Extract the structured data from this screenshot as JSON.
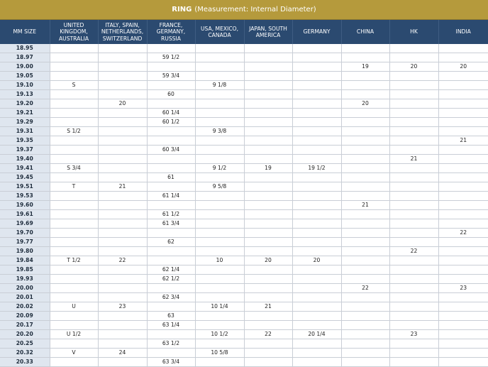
{
  "title": {
    "strong": "RING",
    "rest": "(Measurement: Internal Diameter)"
  },
  "headers": [
    "MM SIZE",
    "UNITED KINGDOM, AUSTRALIA",
    "ITALY, SPAIN, NETHERLANDS, SWITZERLAND",
    "FRANCE, GERMANY, RUSSIA",
    "USA, MEXICO, CANADA",
    "JAPAN, SOUTH AMERICA",
    "GERMANY",
    "CHINA",
    "HK",
    "INDIA"
  ],
  "rows": [
    [
      "18.95",
      "",
      "",
      "",
      "",
      "",
      "",
      "",
      "",
      ""
    ],
    [
      "18.97",
      "",
      "",
      "59 1/2",
      "",
      "",
      "",
      "",
      "",
      ""
    ],
    [
      "19.00",
      "",
      "",
      "",
      "",
      "",
      "",
      "19",
      "20",
      "20"
    ],
    [
      "19.05",
      "",
      "",
      "59 3/4",
      "",
      "",
      "",
      "",
      "",
      ""
    ],
    [
      "19.10",
      "S",
      "",
      "",
      "9 1/8",
      "",
      "",
      "",
      "",
      ""
    ],
    [
      "19.13",
      "",
      "",
      "60",
      "",
      "",
      "",
      "",
      "",
      ""
    ],
    [
      "19.20",
      "",
      "20",
      "",
      "",
      "",
      "",
      "20",
      "",
      ""
    ],
    [
      "19.21",
      "",
      "",
      "60 1/4",
      "",
      "",
      "",
      "",
      "",
      ""
    ],
    [
      "19.29",
      "",
      "",
      "60 1/2",
      "",
      "",
      "",
      "",
      "",
      ""
    ],
    [
      "19.31",
      "S 1/2",
      "",
      "",
      "9 3/8",
      "",
      "",
      "",
      "",
      ""
    ],
    [
      "19.35",
      "",
      "",
      "",
      "",
      "",
      "",
      "",
      "",
      "21"
    ],
    [
      "19.37",
      "",
      "",
      "60 3/4",
      "",
      "",
      "",
      "",
      "",
      ""
    ],
    [
      "19.40",
      "",
      "",
      "",
      "",
      "",
      "",
      "",
      "21",
      ""
    ],
    [
      "19.41",
      "S 3/4",
      "",
      "",
      "9 1/2",
      "19",
      "19 1/2",
      "",
      "",
      ""
    ],
    [
      "19.45",
      "",
      "",
      "61",
      "",
      "",
      "",
      "",
      "",
      ""
    ],
    [
      "19.51",
      "T",
      "21",
      "",
      "9 5/8",
      "",
      "",
      "",
      "",
      ""
    ],
    [
      "19.53",
      "",
      "",
      "61 1/4",
      "",
      "",
      "",
      "",
      "",
      ""
    ],
    [
      "19.60",
      "",
      "",
      "",
      "",
      "",
      "",
      "21",
      "",
      ""
    ],
    [
      "19.61",
      "",
      "",
      "61 1/2",
      "",
      "",
      "",
      "",
      "",
      ""
    ],
    [
      "19.69",
      "",
      "",
      "61 3/4",
      "",
      "",
      "",
      "",
      "",
      ""
    ],
    [
      "19.70",
      "",
      "",
      "",
      "",
      "",
      "",
      "",
      "",
      "22"
    ],
    [
      "19.77",
      "",
      "",
      "62",
      "",
      "",
      "",
      "",
      "",
      ""
    ],
    [
      "19.80",
      "",
      "",
      "",
      "",
      "",
      "",
      "",
      "22",
      ""
    ],
    [
      "19.84",
      "T 1/2",
      "22",
      "",
      "10",
      "20",
      "20",
      "",
      "",
      ""
    ],
    [
      "19.85",
      "",
      "",
      "62 1/4",
      "",
      "",
      "",
      "",
      "",
      ""
    ],
    [
      "19.93",
      "",
      "",
      "62 1/2",
      "",
      "",
      "",
      "",
      "",
      ""
    ],
    [
      "20.00",
      "",
      "",
      "",
      "",
      "",
      "",
      "22",
      "",
      "23"
    ],
    [
      "20.01",
      "",
      "",
      "62 3/4",
      "",
      "",
      "",
      "",
      "",
      ""
    ],
    [
      "20.02",
      "U",
      "23",
      "",
      "10 1/4",
      "21",
      "",
      "",
      "",
      ""
    ],
    [
      "20.09",
      "",
      "",
      "63",
      "",
      "",
      "",
      "",
      "",
      ""
    ],
    [
      "20.17",
      "",
      "",
      "63 1/4",
      "",
      "",
      "",
      "",
      "",
      ""
    ],
    [
      "20.20",
      "U 1/2",
      "",
      "",
      "10 1/2",
      "22",
      "20 1/4",
      "",
      "23",
      ""
    ],
    [
      "20.25",
      "",
      "",
      "63 1/2",
      "",
      "",
      "",
      "",
      "",
      ""
    ],
    [
      "20.32",
      "V",
      "24",
      "",
      "10 5/8",
      "",
      "",
      "",
      "",
      ""
    ],
    [
      "20.33",
      "",
      "",
      "63 3/4",
      "",
      "",
      "",
      "",
      "",
      ""
    ]
  ]
}
